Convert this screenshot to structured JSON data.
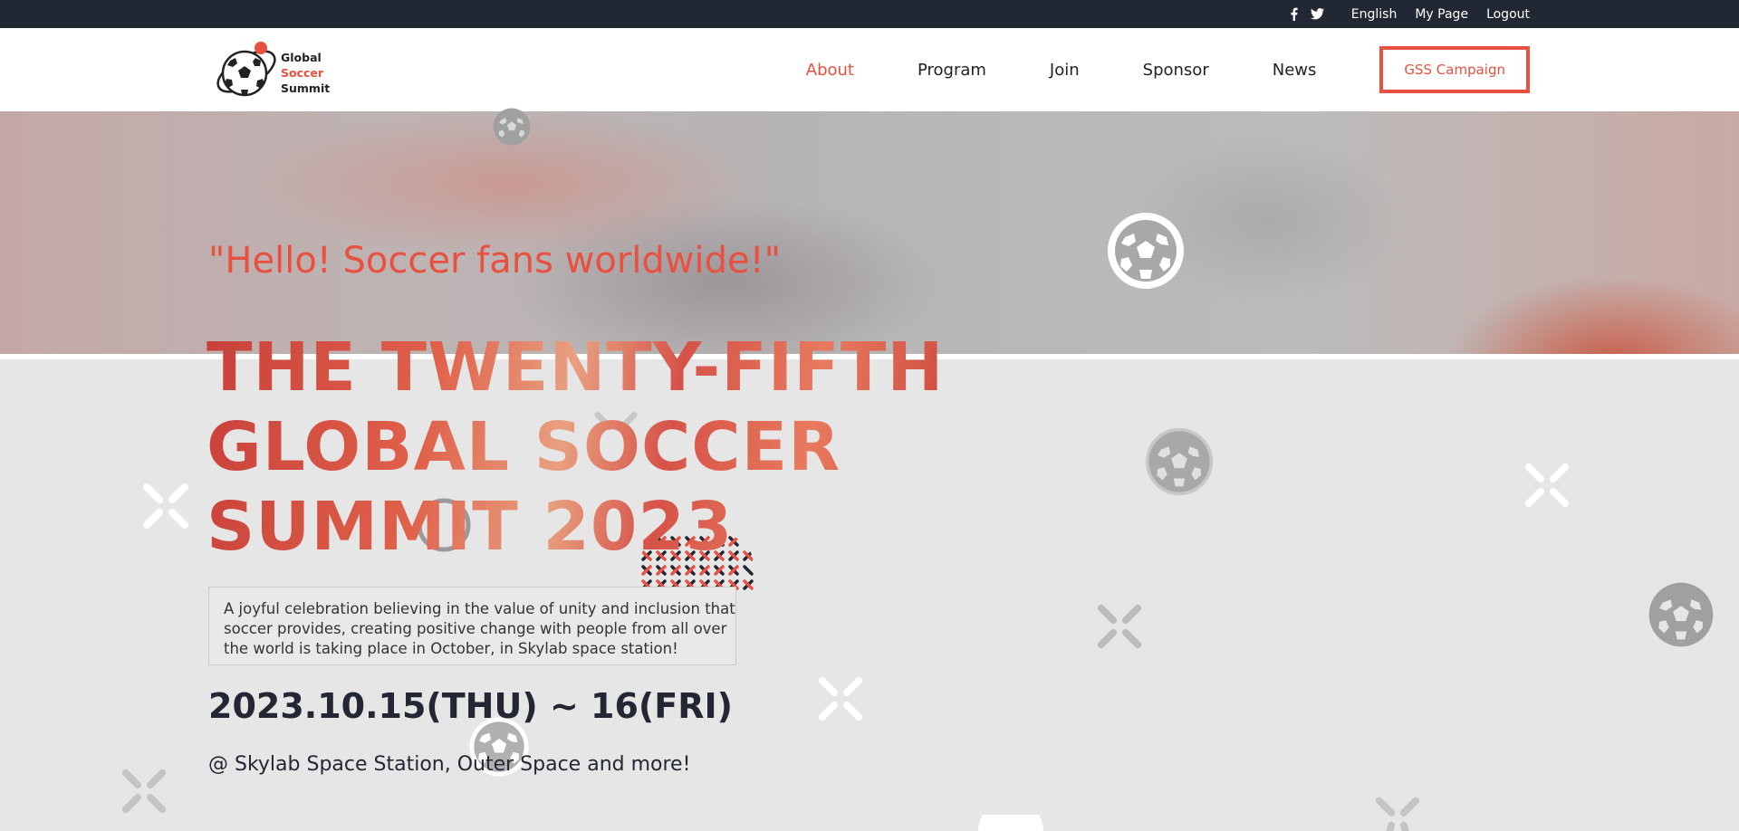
{
  "topbar": {
    "social": [
      "facebook-icon",
      "twitter-icon"
    ],
    "language": "English",
    "my_page": "My Page",
    "logout": "Logout"
  },
  "logo": {
    "line1": "Global",
    "line2": "Soccer",
    "line3": "Summit"
  },
  "nav": {
    "items": [
      {
        "label": "About",
        "active": true
      },
      {
        "label": "Program",
        "active": false
      },
      {
        "label": "Join",
        "active": false
      },
      {
        "label": "Sponsor",
        "active": false
      },
      {
        "label": "News",
        "active": false
      }
    ],
    "cta": "GSS Campaign"
  },
  "hero": {
    "tagline": "\"Hello! Soccer fans worldwide!\"",
    "headline_lines": [
      "THE TWENTY-FIFTH",
      "GLOBAL SOCCER",
      "SUMMIT 2023"
    ],
    "description": "A joyful celebration believing in the value of unity and inclusion that soccer provides, creating positive change with people from all over the world is taking place in October, in Skylab space station!",
    "dates": "2023.10.15(THU) ~ 16(FRI)",
    "venue": "@ Skylab Space Station, Outer Space and more!"
  },
  "colors": {
    "accent": "#e8503f",
    "topbar_bg": "#222833",
    "text_dark": "#232733",
    "page_bg": "#e6e6e6"
  }
}
